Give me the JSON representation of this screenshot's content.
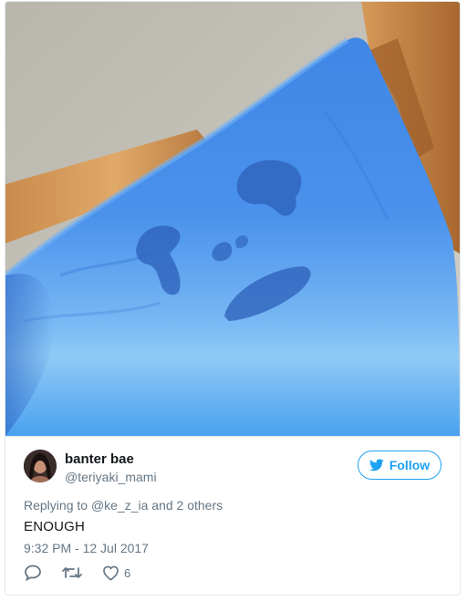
{
  "tweet": {
    "user": {
      "display_name": "banter bae",
      "handle": "@teriyaki_mami"
    },
    "follow_label": "Follow",
    "reply_prefix": "Replying to ",
    "reply_to": "@ke_z_ia",
    "reply_suffix": " and 2 others",
    "text": "ENOUGH",
    "timestamp": "9:32 PM - 12 Jul 2017",
    "like_count": "6"
  },
  "colors": {
    "accent": "#1da1f2",
    "secondary_text": "#657786",
    "primary_text": "#14171a",
    "border": "#e1e8ed"
  },
  "icons": {
    "follow": "bird-icon",
    "reply": "reply-icon",
    "retweet": "retweet-icon",
    "like": "heart-icon"
  }
}
